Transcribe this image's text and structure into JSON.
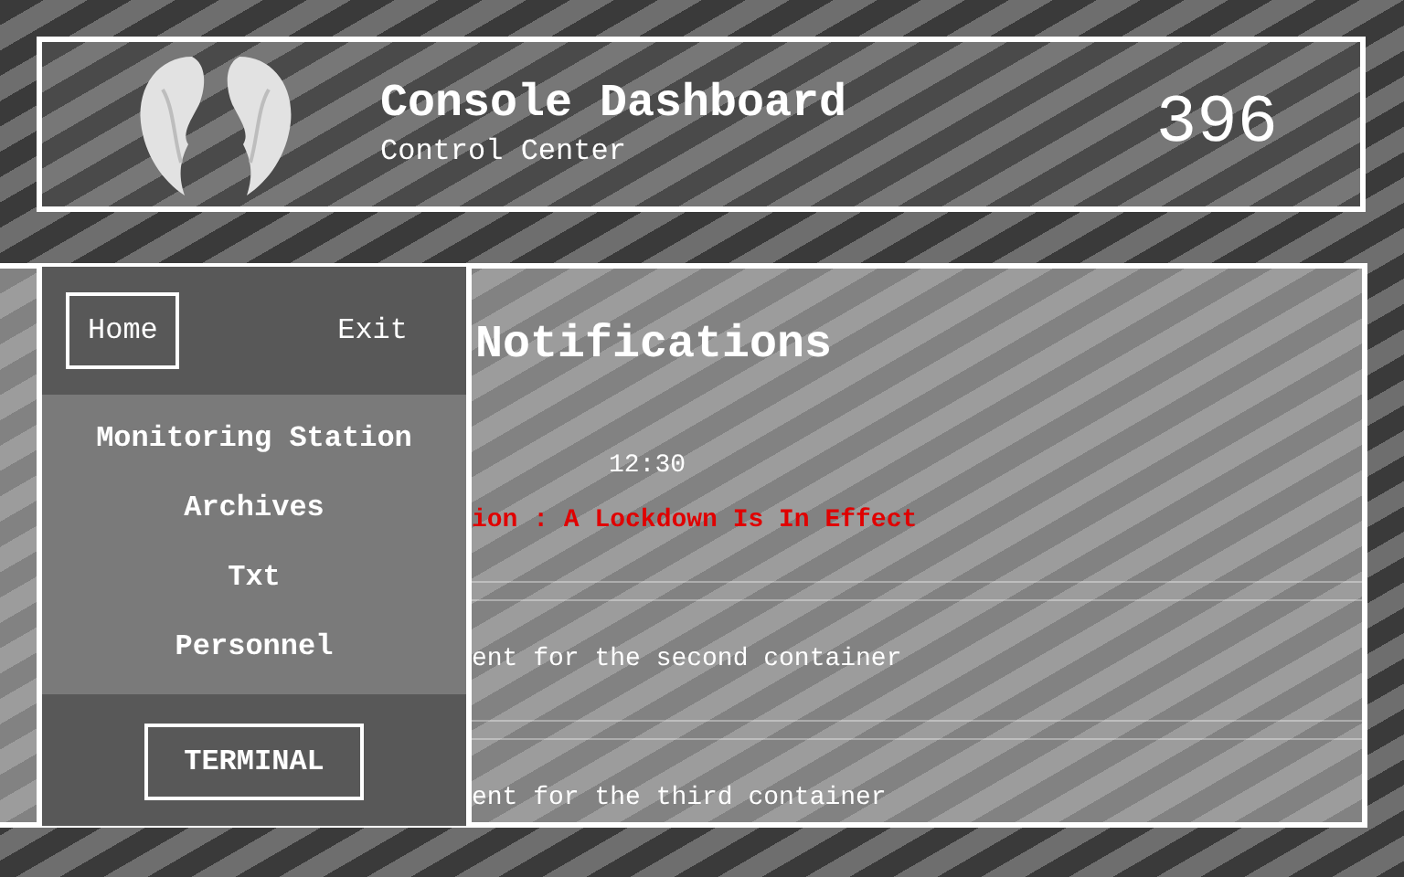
{
  "header": {
    "title": "Console Dashboard",
    "subtitle": "Control Center",
    "counter": "396"
  },
  "nav": {
    "top": [
      {
        "label": "Home",
        "selected": true
      },
      {
        "label": "Exit",
        "selected": false
      }
    ],
    "items": [
      "Monitoring Station",
      "Archives",
      "Txt",
      "Personnel"
    ],
    "terminal": "TERMINAL"
  },
  "notifications": {
    "title": "Notifications",
    "items": [
      {
        "kind": "alert",
        "time": "12:30",
        "text": "ion : A Lockdown Is In Effect"
      },
      {
        "kind": "normal",
        "text": "ent for the second container"
      },
      {
        "kind": "normal",
        "text": "ent for the third container"
      }
    ]
  }
}
